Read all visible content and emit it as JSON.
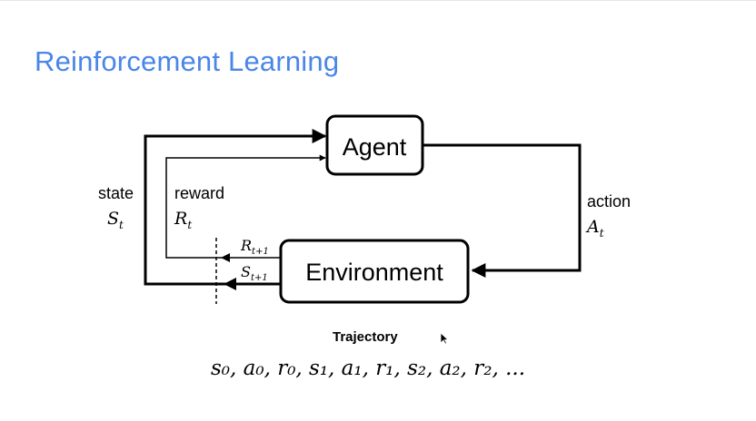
{
  "slide": {
    "title": "Reinforcement Learning"
  },
  "diagram": {
    "agent_label": "Agent",
    "environment_label": "Environment",
    "state_label": "state",
    "state_symbol": "S",
    "state_sub": "t",
    "reward_label": "reward",
    "reward_symbol": "R",
    "reward_sub": "t",
    "action_label": "action",
    "action_symbol": "A",
    "action_sub": "t",
    "next_reward_symbol": "R",
    "next_reward_sub": "t+1",
    "next_state_symbol": "S",
    "next_state_sub": "t+1"
  },
  "trajectory": {
    "caption": "Trajectory",
    "sequence": "s₀, a₀, r₀, s₁, a₁, r₁, s₂, a₂, r₂, ..."
  },
  "icons": {
    "cursor": "mouse-pointer-icon"
  }
}
